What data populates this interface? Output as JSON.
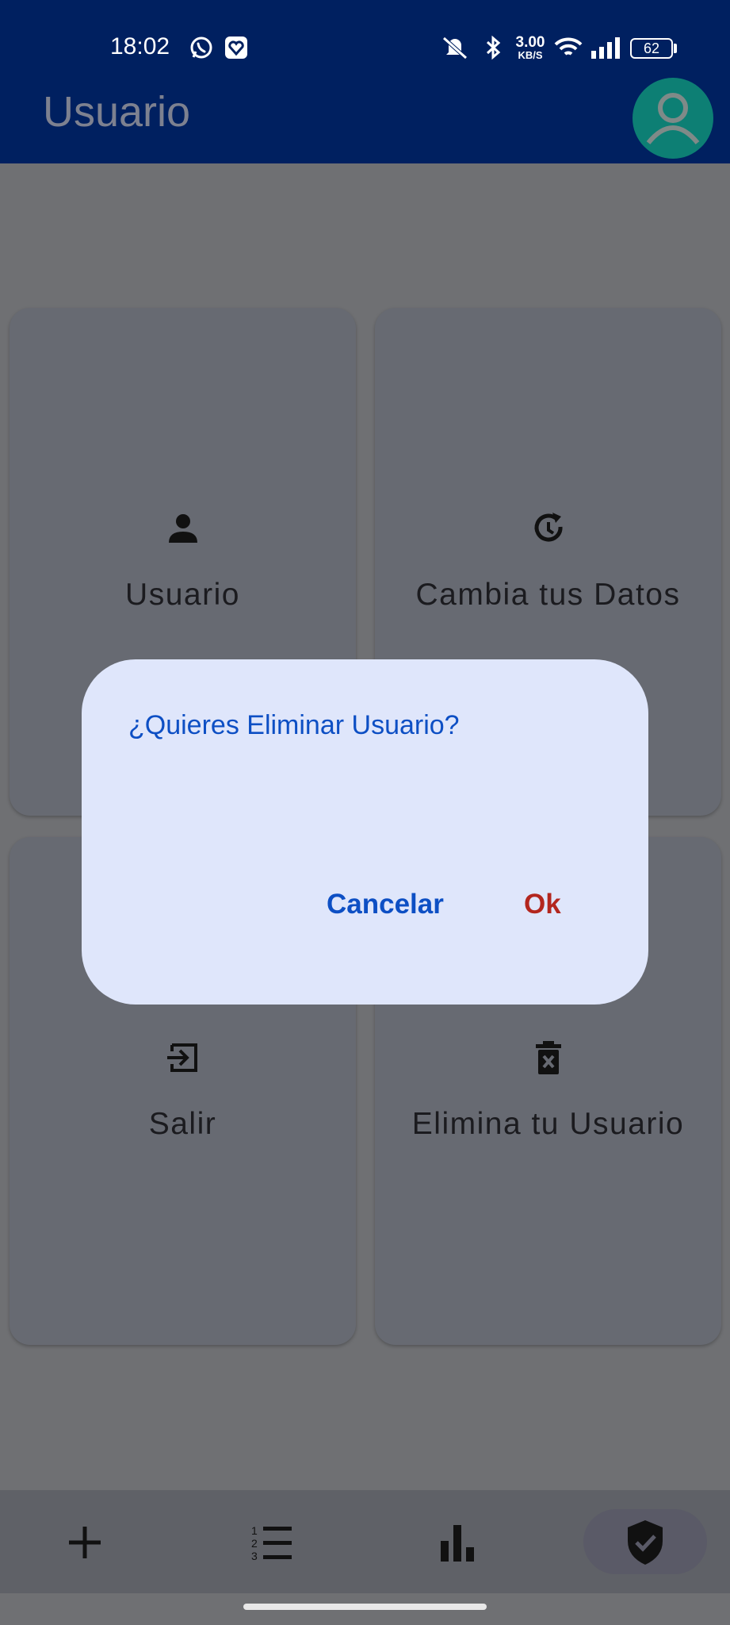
{
  "status_bar": {
    "time": "18:02",
    "net_speed_value": "3.00",
    "net_speed_unit": "KB/S",
    "battery": "62"
  },
  "app_bar": {
    "title": "Usuario"
  },
  "cards": [
    {
      "label": "Usuario",
      "icon": "person-icon"
    },
    {
      "label": "Cambia tus Datos",
      "icon": "history-refresh-icon"
    },
    {
      "label": "Salir",
      "icon": "exit-icon"
    },
    {
      "label": "Elimina tu Usuario",
      "icon": "delete-x-icon"
    }
  ],
  "dialog": {
    "message": "¿Quieres Eliminar Usuario?",
    "cancel_label": "Cancelar",
    "ok_label": "Ok",
    "cancel_color": "#0d4fc4",
    "ok_color": "#b3261e"
  },
  "bottom_nav": [
    {
      "icon": "add-icon"
    },
    {
      "icon": "numbered-list-icon"
    },
    {
      "icon": "bar-chart-icon"
    },
    {
      "icon": "verified-shield-icon",
      "active": true
    }
  ]
}
